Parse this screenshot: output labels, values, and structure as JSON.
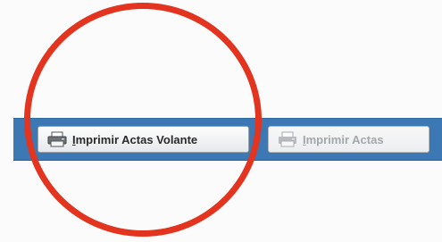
{
  "toolbar": {
    "buttons": [
      {
        "first_letter": "I",
        "rest": "mprimir Actas Volante",
        "icon": "printer-icon",
        "state": "enabled"
      },
      {
        "first_letter": "I",
        "rest": "mprimir Actas",
        "icon": "printer-icon",
        "state": "disabled"
      }
    ]
  },
  "annotation": {
    "shape": "circle",
    "color": "#e2341e"
  },
  "colors": {
    "toolbar_bg": "#3b78b4",
    "annotation": "#e2341e"
  }
}
